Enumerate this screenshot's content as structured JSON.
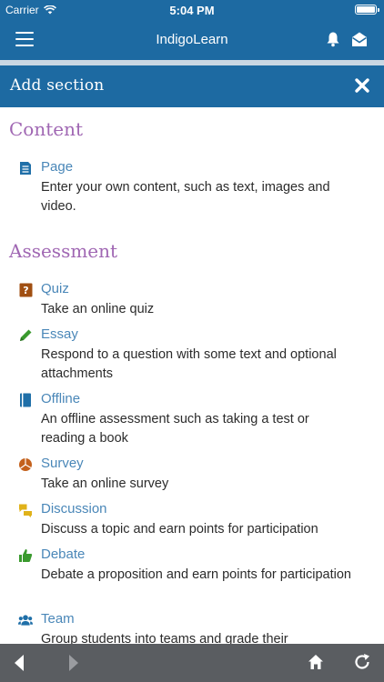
{
  "status": {
    "carrier": "Carrier",
    "time": "5:04 PM"
  },
  "nav": {
    "title": "IndigoLearn"
  },
  "header": {
    "title": "Add section"
  },
  "content_group": {
    "title": "Content",
    "items": [
      {
        "name": "Page",
        "description": "Enter your own content, such as text, images and video.",
        "icon": "page-icon"
      }
    ]
  },
  "assessment_group": {
    "title": "Assessment",
    "items": [
      {
        "name": "Quiz",
        "description": "Take an online quiz",
        "icon": "quiz-icon"
      },
      {
        "name": "Essay",
        "description": "Respond to a question with some text and optional attachments",
        "icon": "pencil-icon"
      },
      {
        "name": "Offline",
        "description": "An offline assessment such as taking a test or reading a book",
        "icon": "book-icon"
      },
      {
        "name": "Survey",
        "description": "Take an online survey",
        "icon": "pie-chart-icon"
      },
      {
        "name": "Discussion",
        "description": "Discuss a topic and earn points for participation",
        "icon": "chat-bubbles-icon"
      },
      {
        "name": "Debate",
        "description": "Debate a proposition and earn points for participation",
        "icon": "thumbs-up-icon"
      },
      {
        "name": "Team",
        "description": "Group students into teams and grade their",
        "icon": "users-icon"
      }
    ]
  },
  "colors": {
    "brand": "#1d6aa2",
    "section_heading": "#a067b3",
    "link": "#4a87b8",
    "toolbar": "#5a5d61"
  }
}
